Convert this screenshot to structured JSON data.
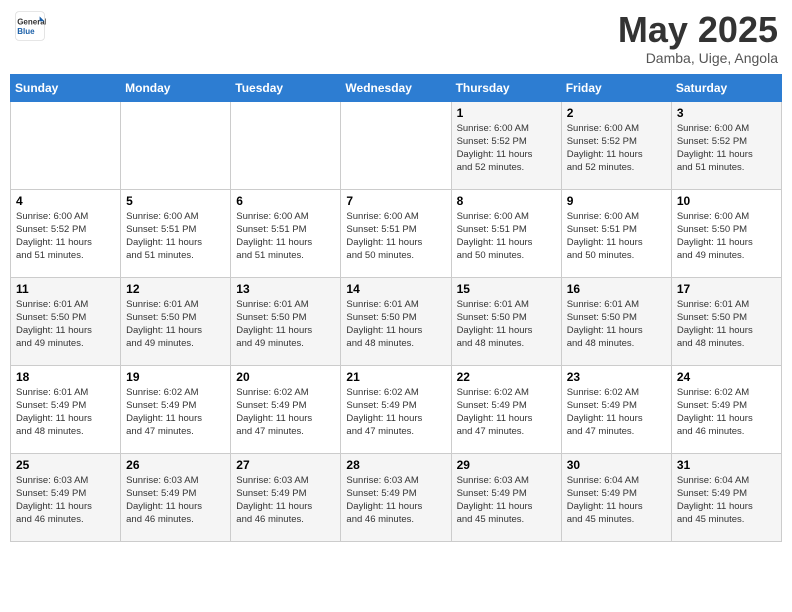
{
  "header": {
    "logo_general": "General",
    "logo_blue": "Blue",
    "month_title": "May 2025",
    "location": "Damba, Uige, Angola"
  },
  "weekdays": [
    "Sunday",
    "Monday",
    "Tuesday",
    "Wednesday",
    "Thursday",
    "Friday",
    "Saturday"
  ],
  "weeks": [
    [
      {
        "day": "",
        "info": ""
      },
      {
        "day": "",
        "info": ""
      },
      {
        "day": "",
        "info": ""
      },
      {
        "day": "",
        "info": ""
      },
      {
        "day": "1",
        "info": "Sunrise: 6:00 AM\nSunset: 5:52 PM\nDaylight: 11 hours\nand 52 minutes."
      },
      {
        "day": "2",
        "info": "Sunrise: 6:00 AM\nSunset: 5:52 PM\nDaylight: 11 hours\nand 52 minutes."
      },
      {
        "day": "3",
        "info": "Sunrise: 6:00 AM\nSunset: 5:52 PM\nDaylight: 11 hours\nand 51 minutes."
      }
    ],
    [
      {
        "day": "4",
        "info": "Sunrise: 6:00 AM\nSunset: 5:52 PM\nDaylight: 11 hours\nand 51 minutes."
      },
      {
        "day": "5",
        "info": "Sunrise: 6:00 AM\nSunset: 5:51 PM\nDaylight: 11 hours\nand 51 minutes."
      },
      {
        "day": "6",
        "info": "Sunrise: 6:00 AM\nSunset: 5:51 PM\nDaylight: 11 hours\nand 51 minutes."
      },
      {
        "day": "7",
        "info": "Sunrise: 6:00 AM\nSunset: 5:51 PM\nDaylight: 11 hours\nand 50 minutes."
      },
      {
        "day": "8",
        "info": "Sunrise: 6:00 AM\nSunset: 5:51 PM\nDaylight: 11 hours\nand 50 minutes."
      },
      {
        "day": "9",
        "info": "Sunrise: 6:00 AM\nSunset: 5:51 PM\nDaylight: 11 hours\nand 50 minutes."
      },
      {
        "day": "10",
        "info": "Sunrise: 6:00 AM\nSunset: 5:50 PM\nDaylight: 11 hours\nand 49 minutes."
      }
    ],
    [
      {
        "day": "11",
        "info": "Sunrise: 6:01 AM\nSunset: 5:50 PM\nDaylight: 11 hours\nand 49 minutes."
      },
      {
        "day": "12",
        "info": "Sunrise: 6:01 AM\nSunset: 5:50 PM\nDaylight: 11 hours\nand 49 minutes."
      },
      {
        "day": "13",
        "info": "Sunrise: 6:01 AM\nSunset: 5:50 PM\nDaylight: 11 hours\nand 49 minutes."
      },
      {
        "day": "14",
        "info": "Sunrise: 6:01 AM\nSunset: 5:50 PM\nDaylight: 11 hours\nand 48 minutes."
      },
      {
        "day": "15",
        "info": "Sunrise: 6:01 AM\nSunset: 5:50 PM\nDaylight: 11 hours\nand 48 minutes."
      },
      {
        "day": "16",
        "info": "Sunrise: 6:01 AM\nSunset: 5:50 PM\nDaylight: 11 hours\nand 48 minutes."
      },
      {
        "day": "17",
        "info": "Sunrise: 6:01 AM\nSunset: 5:50 PM\nDaylight: 11 hours\nand 48 minutes."
      }
    ],
    [
      {
        "day": "18",
        "info": "Sunrise: 6:01 AM\nSunset: 5:49 PM\nDaylight: 11 hours\nand 48 minutes."
      },
      {
        "day": "19",
        "info": "Sunrise: 6:02 AM\nSunset: 5:49 PM\nDaylight: 11 hours\nand 47 minutes."
      },
      {
        "day": "20",
        "info": "Sunrise: 6:02 AM\nSunset: 5:49 PM\nDaylight: 11 hours\nand 47 minutes."
      },
      {
        "day": "21",
        "info": "Sunrise: 6:02 AM\nSunset: 5:49 PM\nDaylight: 11 hours\nand 47 minutes."
      },
      {
        "day": "22",
        "info": "Sunrise: 6:02 AM\nSunset: 5:49 PM\nDaylight: 11 hours\nand 47 minutes."
      },
      {
        "day": "23",
        "info": "Sunrise: 6:02 AM\nSunset: 5:49 PM\nDaylight: 11 hours\nand 47 minutes."
      },
      {
        "day": "24",
        "info": "Sunrise: 6:02 AM\nSunset: 5:49 PM\nDaylight: 11 hours\nand 46 minutes."
      }
    ],
    [
      {
        "day": "25",
        "info": "Sunrise: 6:03 AM\nSunset: 5:49 PM\nDaylight: 11 hours\nand 46 minutes."
      },
      {
        "day": "26",
        "info": "Sunrise: 6:03 AM\nSunset: 5:49 PM\nDaylight: 11 hours\nand 46 minutes."
      },
      {
        "day": "27",
        "info": "Sunrise: 6:03 AM\nSunset: 5:49 PM\nDaylight: 11 hours\nand 46 minutes."
      },
      {
        "day": "28",
        "info": "Sunrise: 6:03 AM\nSunset: 5:49 PM\nDaylight: 11 hours\nand 46 minutes."
      },
      {
        "day": "29",
        "info": "Sunrise: 6:03 AM\nSunset: 5:49 PM\nDaylight: 11 hours\nand 45 minutes."
      },
      {
        "day": "30",
        "info": "Sunrise: 6:04 AM\nSunset: 5:49 PM\nDaylight: 11 hours\nand 45 minutes."
      },
      {
        "day": "31",
        "info": "Sunrise: 6:04 AM\nSunset: 5:49 PM\nDaylight: 11 hours\nand 45 minutes."
      }
    ]
  ]
}
